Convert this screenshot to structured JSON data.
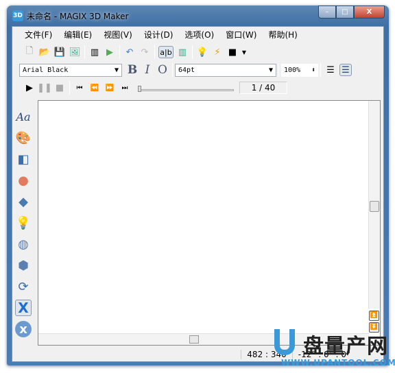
{
  "window": {
    "title": "未命名 - MAGIX 3D Maker",
    "app_icon": "3D",
    "min": "–",
    "max": "□",
    "close": "X"
  },
  "menu": [
    "文件(F)",
    "编辑(E)",
    "视图(V)",
    "设计(D)",
    "选项(O)",
    "窗口(W)",
    "帮助(H)"
  ],
  "format": {
    "font": "Arial Black",
    "size": "64pt",
    "zoom": "100%",
    "bold": "B",
    "italic": "I",
    "outline": "O"
  },
  "playback": {
    "frame": "1 / 40",
    "progress": 0
  },
  "toolbar_icons": [
    "new-icon",
    "open-icon",
    "save-icon",
    "export-image-icon",
    "animation-edit-icon",
    "animation-apply-icon",
    "undo-icon",
    "redo-icon",
    "text-edit-icon",
    "preview-animation-icon",
    "light-icon",
    "effects-icon",
    "background-icon"
  ],
  "left_tools": {
    "text": "Aa",
    "icons": [
      "font-icon",
      "color-palette-icon",
      "extrude-icon",
      "material-icon",
      "bevel-icon",
      "lighting-icon",
      "texture-icon",
      "objects-icon",
      "rotate-icon",
      "x-object-icon",
      "x-circle-icon"
    ]
  },
  "status": {
    "coords": "482 : 340",
    "rotation": "-12° : 0° : 0°"
  },
  "watermark": {
    "brand": "盘量产网",
    "url": "WWW.UPANTOOL.COM"
  }
}
